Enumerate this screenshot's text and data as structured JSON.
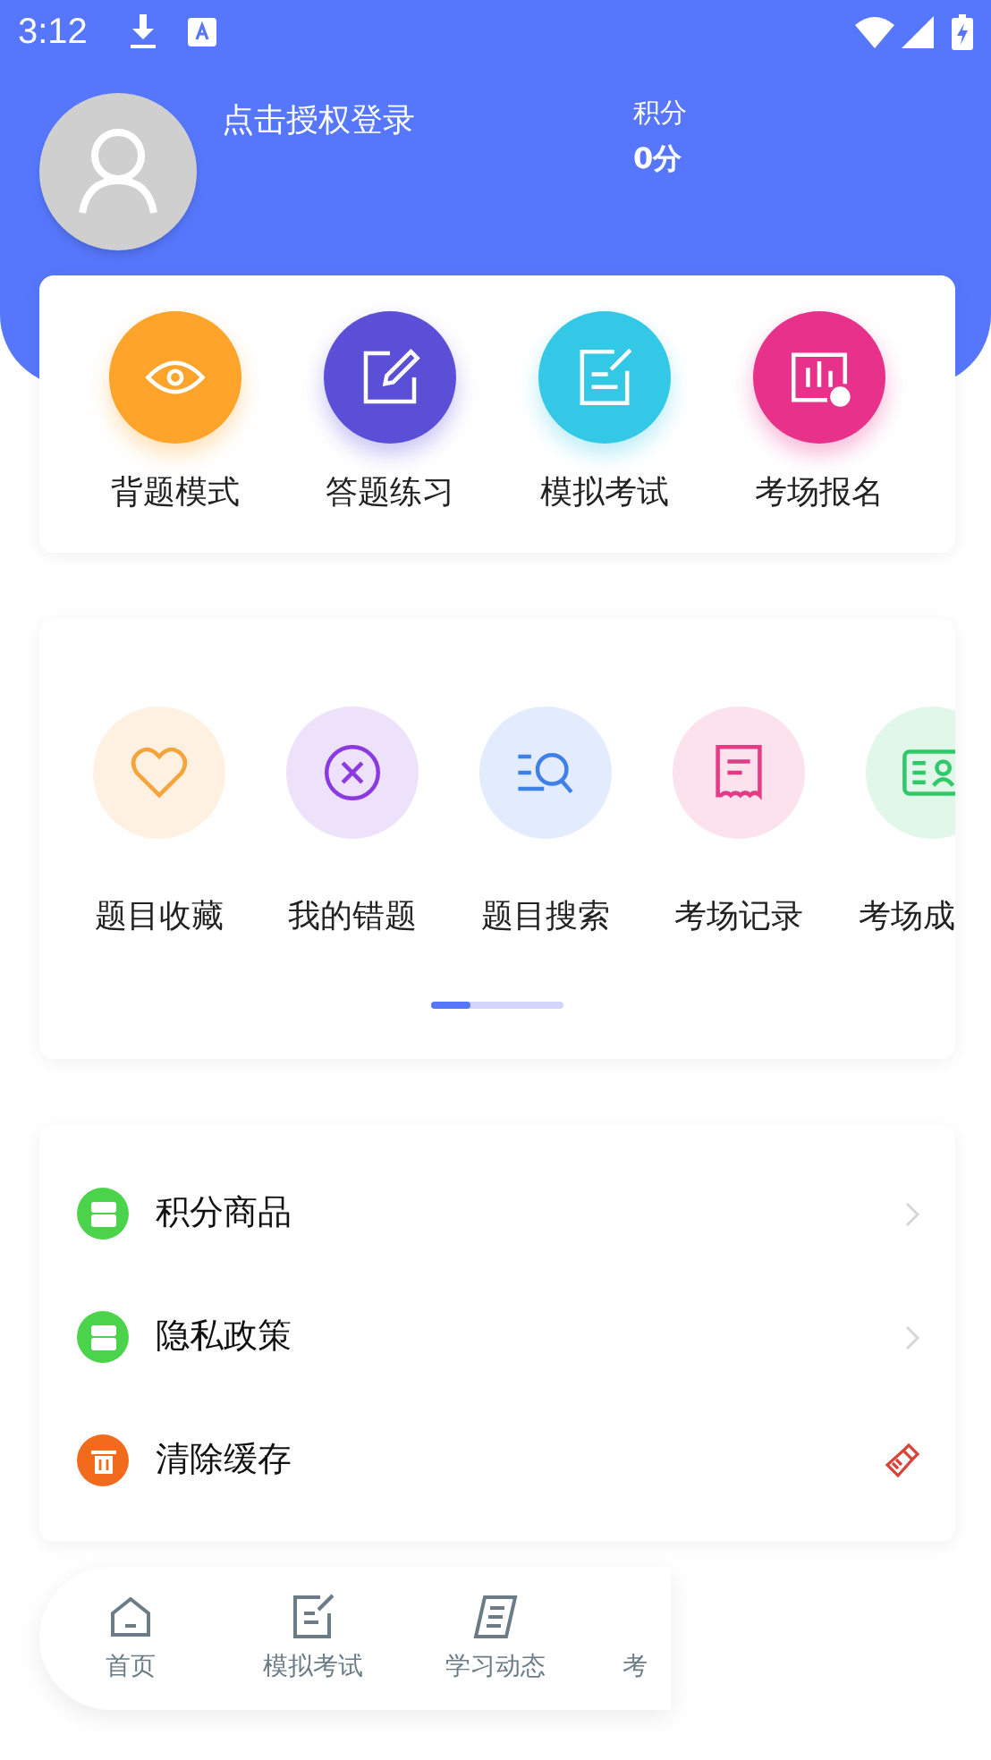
{
  "status_bar": {
    "time": "3:12"
  },
  "profile": {
    "login_text": "点击授权登录",
    "points_label": "积分",
    "points_value": "0分"
  },
  "main_features": [
    {
      "label": "背题模式",
      "color": "#ffa42a"
    },
    {
      "label": "答题练习",
      "color": "#5b4fd8"
    },
    {
      "label": "模拟考试",
      "color": "#33c8e6"
    },
    {
      "label": "考场报名",
      "color": "#e8318a"
    }
  ],
  "tools": {
    "items": [
      {
        "label": "题目收藏",
        "color": "#f5a43a"
      },
      {
        "label": "我的错题",
        "color": "#8a3ae0"
      },
      {
        "label": "题目搜索",
        "color": "#3f7fe8"
      },
      {
        "label": "考场记录",
        "color": "#e53a86"
      },
      {
        "label": "考场成",
        "color": "#2fc96a"
      }
    ],
    "scroll": {
      "level": 0.3
    }
  },
  "menu": [
    {
      "label": "积分商品",
      "color": "#4cd34c",
      "kind": "link"
    },
    {
      "label": "隐私政策",
      "color": "#4cd34c",
      "kind": "link"
    },
    {
      "label": "清除缓存",
      "color": "#f26a1b",
      "kind": "action"
    }
  ],
  "bottom_nav": [
    {
      "label": "首页"
    },
    {
      "label": "模拟考试"
    },
    {
      "label": "学习动态"
    },
    {
      "label": "考"
    }
  ]
}
